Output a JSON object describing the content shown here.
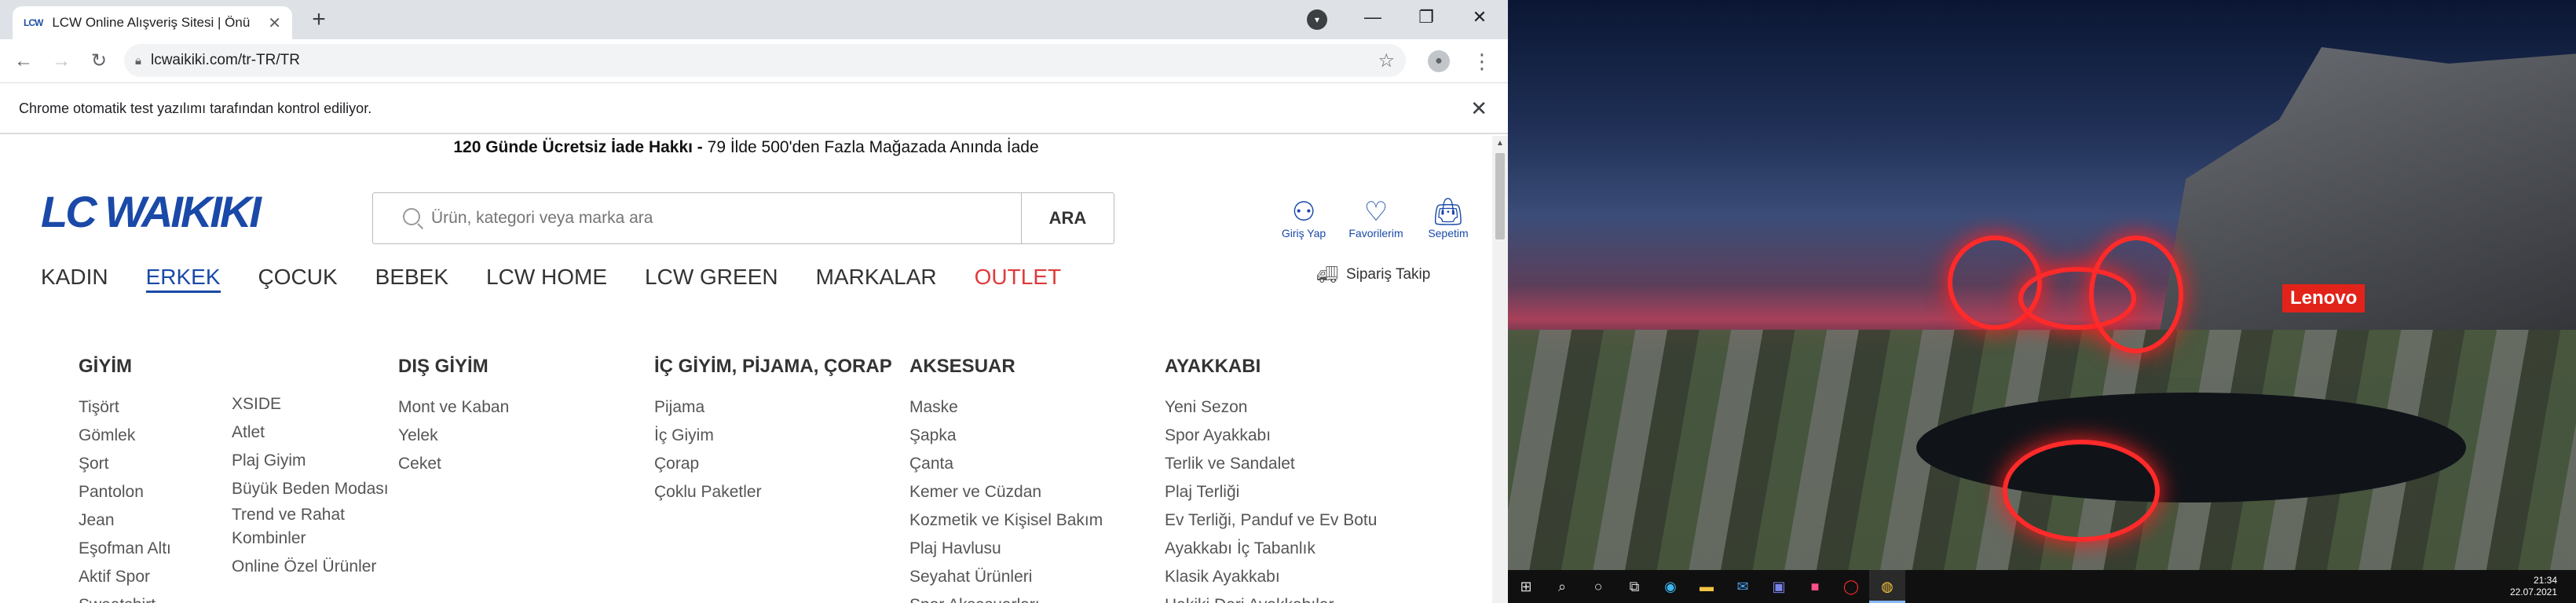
{
  "browser": {
    "tab_favicon": "LCW",
    "tab_title": "LCW Online Alışveriş Sitesi | Önü",
    "tab_close": "✕",
    "new_tab": "+",
    "url": "lcwaikiki.com/tr-TR/TR",
    "automation_notice": "Chrome otomatik test yazılımı tarafından kontrol ediliyor."
  },
  "site": {
    "promo_bold": "120 Günde Ücretsiz İade Hakkı -",
    "promo_rest": " 79 İlde 500'den Fazla Mağazada Anında İade",
    "logo": "LC WAIKIKI",
    "search_placeholder": "Ürün, kategori veya marka ara",
    "search_button": "ARA",
    "user_actions": [
      {
        "label": "Giriş Yap",
        "icon": "user-icon"
      },
      {
        "label": "Favorilerim",
        "icon": "heart-icon"
      },
      {
        "label": "Sepetim",
        "icon": "bag-icon"
      }
    ],
    "menu": [
      "KADIN",
      "ERKEK",
      "ÇOCUK",
      "BEBEK",
      "LCW HOME",
      "LCW GREEN",
      "MARKALAR",
      "OUTLET"
    ],
    "active_menu": "ERKEK",
    "order_tracking": "Sipariş Takip",
    "columns": {
      "giyim": {
        "title": "GİYİM",
        "items_a": [
          "Tişört",
          "Gömlek",
          "Şort",
          "Pantolon",
          "Jean",
          "Eşofman Altı",
          "Aktif Spor",
          "Sweatshirt"
        ],
        "items_b": [
          "XSIDE",
          "Atlet",
          "Plaj Giyim",
          "Büyük Beden Modası",
          "Trend ve Rahat Kombinler",
          "Online Özel Ürünler"
        ]
      },
      "dis_giyim": {
        "title": "DIŞ GİYİM",
        "items": [
          "Mont ve Kaban",
          "Yelek",
          "Ceket"
        ]
      },
      "ic_giyim": {
        "title": "İÇ GİYİM, PİJAMA, ÇORAP",
        "items": [
          "Pijama",
          "İç Giyim",
          "Çorap",
          "Çoklu Paketler"
        ]
      },
      "aksesuar": {
        "title": "AKSESUAR",
        "items": [
          "Maske",
          "Şapka",
          "Çanta",
          "Kemer ve Cüzdan",
          "Kozmetik ve Kişisel Bakım",
          "Plaj Havlusu",
          "Seyahat Ürünleri",
          "Spor Aksesuarları"
        ]
      },
      "ayakkabi": {
        "title": "AYAKKABI",
        "items": [
          "Yeni Sezon",
          "Spor Ayakkabı",
          "Terlik ve Sandalet",
          "Plaj Terliği",
          "Ev Terliği, Panduf ve Ev Botu",
          "Ayakkabı İç Tabanlık",
          "Klasik Ayakkabı",
          "Hakiki Deri Ayakkabılar"
        ]
      }
    }
  },
  "desktop": {
    "brand_badge": "Lenovo",
    "clock_time": "21:34",
    "clock_date": "22.07.2021"
  },
  "colors": {
    "brand_blue": "#1a49a8",
    "outlet_red": "#e03a3a"
  }
}
